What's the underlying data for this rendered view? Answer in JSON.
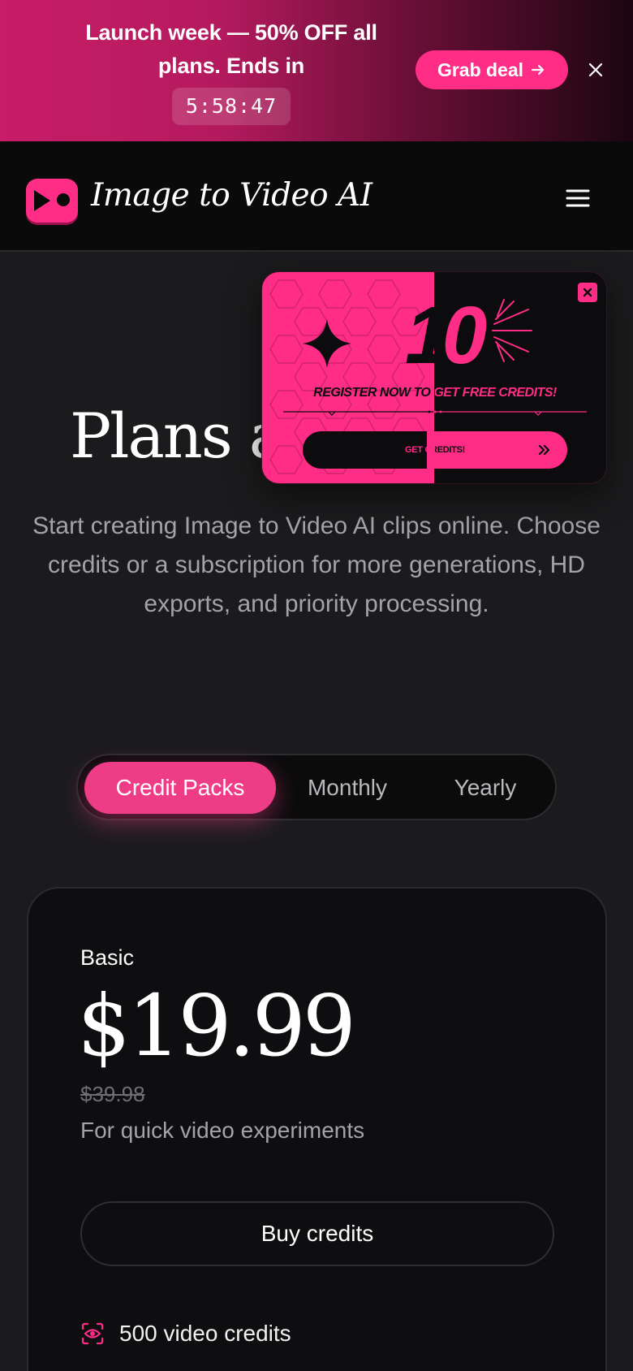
{
  "promo": {
    "text": "Launch week — 50% OFF all plans. Ends in",
    "timer": "5:58:47",
    "cta_label": "Grab deal"
  },
  "header": {
    "app_name": "Image to Video AI"
  },
  "hero": {
    "title": "Plans and Pricing",
    "subtitle": "Start creating Image to Video AI clips online. Choose credits or a subscription for more generations, HD exports, and priority processing."
  },
  "tabs": [
    {
      "label": "Credit Packs",
      "active": true
    },
    {
      "label": "Monthly",
      "active": false
    },
    {
      "label": "Yearly",
      "active": false
    }
  ],
  "plan": {
    "name": "Basic",
    "price": "$19.99",
    "old_price": "$39.98",
    "description": "For quick video experiments",
    "cta_label": "Buy credits",
    "features": [
      "500 video credits"
    ]
  },
  "popup": {
    "number": "10",
    "headline": "REGISTER NOW TO GET FREE CREDITS!",
    "cta_label": "GET CREDITS!"
  },
  "colors": {
    "accent": "#ff2d86",
    "background": "#1b1b1d",
    "card": "#0e0e11"
  }
}
